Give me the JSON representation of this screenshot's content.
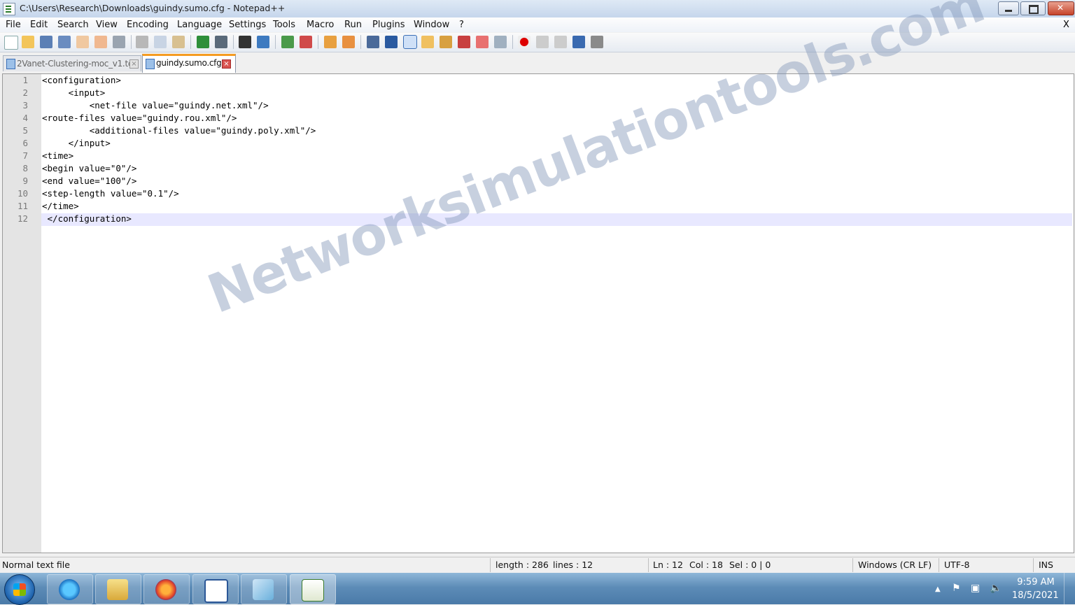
{
  "window": {
    "title": "C:\\Users\\Research\\Downloads\\guindy.sumo.cfg - Notepad++",
    "close_x": "X"
  },
  "menu": [
    "File",
    "Edit",
    "Search",
    "View",
    "Encoding",
    "Language",
    "Settings",
    "Tools",
    "Macro",
    "Run",
    "Plugins",
    "Window",
    "?"
  ],
  "toolbar_icons": [
    "new-file-icon",
    "open-file-icon",
    "save-icon",
    "save-all-icon",
    "close-icon",
    "close-all-icon",
    "print-icon",
    "cut-icon",
    "copy-icon",
    "paste-icon",
    "undo-icon",
    "redo-icon",
    "find-icon",
    "replace-icon",
    "zoom-in-icon",
    "zoom-out-icon",
    "sync-vertical-icon",
    "sync-horizontal-icon",
    "word-wrap-icon",
    "show-all-chars-icon",
    "indent-guide-icon",
    "user-language-icon",
    "doc-map-icon",
    "function-list-icon",
    "folder-workspace-icon",
    "monitoring-icon",
    "record-macro-icon",
    "stop-record-icon",
    "play-macro-icon",
    "run-macro-multiple-icon",
    "save-macro-icon"
  ],
  "tabs": [
    {
      "label": "2Vanet-Clustering-moc_v1.tcl",
      "active": false
    },
    {
      "label": "guindy.sumo.cfg",
      "active": true
    }
  ],
  "editor": {
    "lines": [
      {
        "num": "1",
        "text": "<configuration>"
      },
      {
        "num": "2",
        "text": "     <input>"
      },
      {
        "num": "3",
        "text": "         <net-file value=\"guindy.net.xml\"/>"
      },
      {
        "num": "4",
        "text": "<route-files value=\"guindy.rou.xml\"/>"
      },
      {
        "num": "5",
        "text": "         <additional-files value=\"guindy.poly.xml\"/>"
      },
      {
        "num": "6",
        "text": "     </input>"
      },
      {
        "num": "7",
        "text": "<time>"
      },
      {
        "num": "8",
        "text": "<begin value=\"0\"/>"
      },
      {
        "num": "9",
        "text": "<end value=\"100\"/>"
      },
      {
        "num": "10",
        "text": "<step-length value=\"0.1\"/>"
      },
      {
        "num": "11",
        "text": "</time>"
      },
      {
        "num": "12",
        "text": " </configuration>"
      }
    ],
    "current_line": 12
  },
  "watermark": "Networksimulationtools.com",
  "status": {
    "file_type": "Normal text file",
    "length": "length : 286",
    "lines": "lines : 12",
    "ln": "Ln : 12",
    "col": "Col : 18",
    "sel": "Sel : 0 | 0",
    "eol": "Windows (CR LF)",
    "encoding": "UTF-8",
    "mode": "INS"
  },
  "taskbar": {
    "apps": [
      "internet-explorer-icon",
      "file-explorer-icon",
      "firefox-icon",
      "word-icon",
      "notepad-icon",
      "notepadpp-icon"
    ],
    "clock_time": "9:59 AM",
    "clock_date": "18/5/2021"
  },
  "colors": {
    "active_tab_accent": "#f59c22",
    "current_line_bg": "#e8e8ff",
    "watermark": "#8296b9"
  }
}
